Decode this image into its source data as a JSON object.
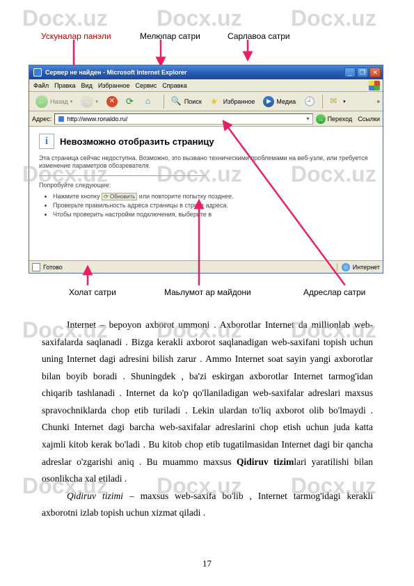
{
  "watermark": "Docx.uz",
  "labels": {
    "tools_panel": "Ускуналар панэли",
    "menu_bar": "Мелюпар сатри",
    "title_bar": "Сарлавоа сатри",
    "status_bar": "Холат сатри",
    "content_area": "Маьлумот ар майдони",
    "address_bar": "Адреслар сатри"
  },
  "browser": {
    "title": "Сервер не найден - Microsoft Internet Explorer",
    "menu": {
      "file": "Файл",
      "edit": "Правка",
      "view": "Вид",
      "favorites": "Избранное",
      "tools": "Сервис",
      "help": "Справка"
    },
    "toolbar": {
      "back": "Назад",
      "search": "Поиск",
      "favorites": "Избранное",
      "media": "Медиа"
    },
    "addrbar": {
      "label": "Адрес:",
      "url": "http://www.ronaldo.ru/",
      "go": "Переход",
      "links": "Ссылки"
    },
    "error": {
      "heading": "Невозможно отобразить страницу",
      "para1": "Эта страница сейчас недоступна. Возможно, это вызвано техническими проблемами на веб-узле, или требуется изменение параметров обозревателя.",
      "try_following": "Попробуйте следующее:",
      "bullet1a": "Нажмите кнопку",
      "bullet1_btn": "Обновить",
      "bullet1b": "или повторите попытку позднее.",
      "bullet2": "Проверьте правильность адреса страницы в строке адреса.",
      "bullet3": "Чтобы проверить настройки подключения, выберите в"
    },
    "status": {
      "left": "Готово",
      "right": "Интернет"
    }
  },
  "bodytext": {
    "p1a": "Internet – bepoyon axborot ummoni . Axborotlar Internet da millionlab web-saxifalarda saqlanadi . Bizga kerakli axborot saqlanadigan web-saxifani topish uchun uning Internet dagi adresini bilish zarur . Ammo Internet soat sayin yangi axborotlar bilan boyib boradi . Shuningdek , ba'zi eskirgan axborotlar Internet tarmog'idan chiqarib tashlanadi . Internet da ko'p qo'llaniladigan web-saxifalar adreslari maxsus spravochniklarda chop etib turiladi . Lekin ulardan to'liq axborot olib bo'lmaydi . Chunki Internet dagi barcha web-saxifalar adreslarini chop  etish uchun juda katta xajmli kitob kerak bo'ladi . Bu kitob chop etib tugatilmasidan Internet dagi bir qancha adreslar o'zgarishi aniq . Bu muammo maxsus ",
    "p1b": "Qidiruv tizim",
    "p1c": "lari yaratilishi bilan  osonlikcha xal etiladi . ",
    "p2a": "Qidiruv tizimi",
    "p2b": " – maxsus web-saxifa bo'lib , Internet tarmog'idagi kerakli axborotni izlab topish uchun xizmat qiladi ."
  },
  "page_number": "17"
}
